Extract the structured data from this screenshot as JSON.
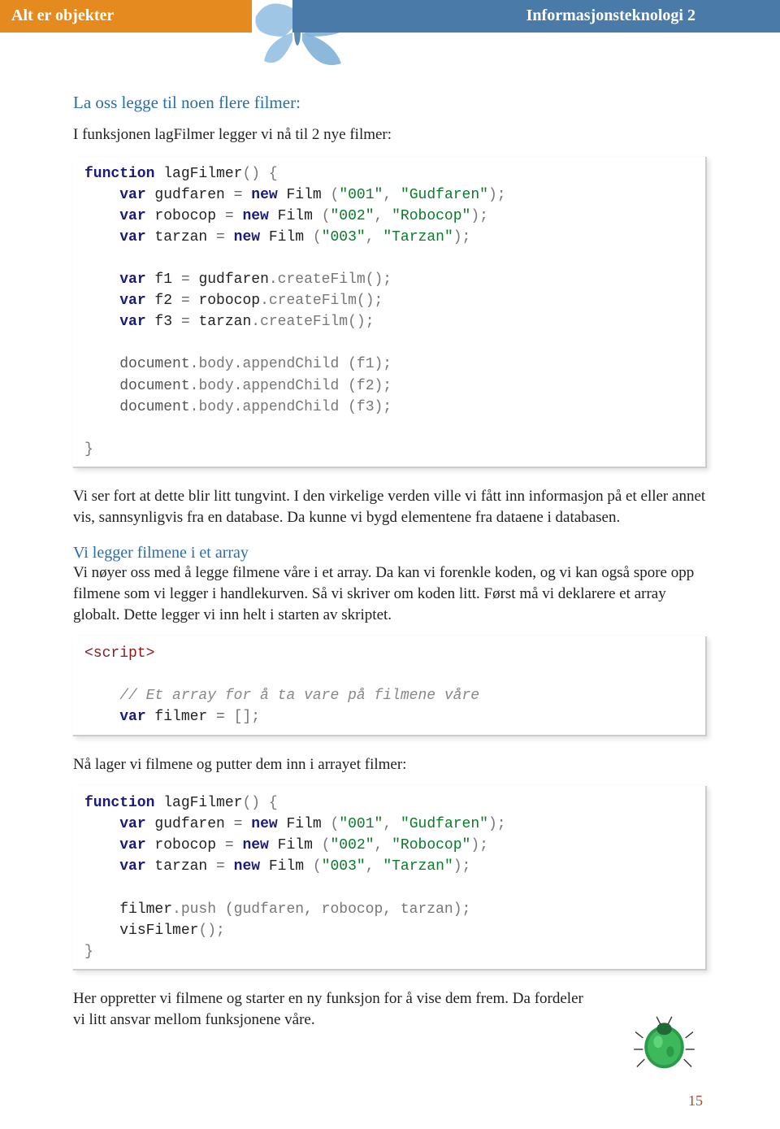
{
  "header": {
    "left": "Alt er objekter",
    "right": "Informasjonsteknologi 2"
  },
  "section1": {
    "heading": "La oss legge til noen flere filmer:",
    "intro": "I funksjonen lagFilmer legger vi nå til 2 nye filmer:"
  },
  "code1": {
    "l1a": "function",
    "l1b": " lagFilmer",
    "l1c": "() {",
    "l2a": "var",
    "l2b": " gudfaren ",
    "l2c": "=",
    "l2d": " new",
    "l2e": " Film ",
    "l2f": "(",
    "l2g": "\"001\"",
    "l2h": ", ",
    "l2i": "\"Gudfaren\"",
    "l2j": ");",
    "l3a": "var",
    "l3b": " robocop ",
    "l3c": "=",
    "l3d": " new",
    "l3e": " Film ",
    "l3f": "(",
    "l3g": "\"002\"",
    "l3h": ", ",
    "l3i": "\"Robocop\"",
    "l3j": ");",
    "l4a": "var",
    "l4b": " tarzan ",
    "l4c": "=",
    "l4d": " new",
    "l4e": " Film ",
    "l4f": "(",
    "l4g": "\"003\"",
    "l4h": ", ",
    "l4i": "\"Tarzan\"",
    "l4j": ");",
    "l5a": "var",
    "l5b": " f1 ",
    "l5c": "=",
    "l5d": " gudfaren",
    "l5e": ".createFilm",
    "l5f": "();",
    "l6a": "var",
    "l6b": " f2 ",
    "l6c": "=",
    "l6d": " robocop",
    "l6e": ".createFilm",
    "l6f": "();",
    "l7a": "var",
    "l7b": " f3 ",
    "l7c": "=",
    "l7d": " tarzan",
    "l7e": ".createFilm",
    "l7f": "();",
    "l8a": "document",
    "l8b": ".body",
    "l8c": ".appendChild ",
    "l8d": "(f1);",
    "l9a": "document",
    "l9b": ".body",
    "l9c": ".appendChild ",
    "l9d": "(f2);",
    "l10a": "document",
    "l10b": ".body",
    "l10c": ".appendChild ",
    "l10d": "(f3);",
    "l11": "}"
  },
  "para1": "Vi ser fort at dette blir litt tungvint. I den virkelige verden ville vi fått inn informasjon på et eller annet vis, sannsynligvis fra en database. Da kunne vi bygd elementene fra dataene i databasen.",
  "section2": {
    "heading": "Vi legger filmene i et array",
    "body": "Vi nøyer oss med å legge filmene våre i et array. Da kan vi forenkle koden, og vi kan også spore opp filmene som vi legger i handlekurven. Så vi skriver om koden litt. Først må vi deklarere et array globalt. Dette legger vi inn helt i starten av skriptet."
  },
  "code2": {
    "l1": "<script>",
    "l2": "// Et array for å ta vare på filmene våre",
    "l3a": "var",
    "l3b": " filmer ",
    "l3c": "=",
    "l3d": " []",
    "l3e": ";"
  },
  "para2": "Nå lager vi filmene og putter dem inn i arrayet filmer:",
  "code3": {
    "l1a": "function",
    "l1b": " lagFilmer",
    "l1c": "() {",
    "l2a": "var",
    "l2b": " gudfaren ",
    "l2c": "=",
    "l2d": " new",
    "l2e": " Film ",
    "l2f": "(",
    "l2g": "\"001\"",
    "l2h": ", ",
    "l2i": "\"Gudfaren\"",
    "l2j": ");",
    "l3a": "var",
    "l3b": " robocop ",
    "l3c": "=",
    "l3d": " new",
    "l3e": " Film ",
    "l3f": "(",
    "l3g": "\"002\"",
    "l3h": ", ",
    "l3i": "\"Robocop\"",
    "l3j": ");",
    "l4a": "var",
    "l4b": " tarzan ",
    "l4c": "=",
    "l4d": " new",
    "l4e": " Film ",
    "l4f": "(",
    "l4g": "\"003\"",
    "l4h": ", ",
    "l4i": "\"Tarzan\"",
    "l4j": ");",
    "l5a": "filmer",
    "l5b": ".push ",
    "l5c": "(gudfaren, robocop, tarzan);",
    "l6a": "visFilmer",
    "l6b": "();",
    "l7": "}"
  },
  "para3": "Her oppretter vi filmene og starter en ny funksjon for å vise dem frem. Da fordeler vi litt ansvar mellom funksjonene våre.",
  "pageNumber": "15"
}
